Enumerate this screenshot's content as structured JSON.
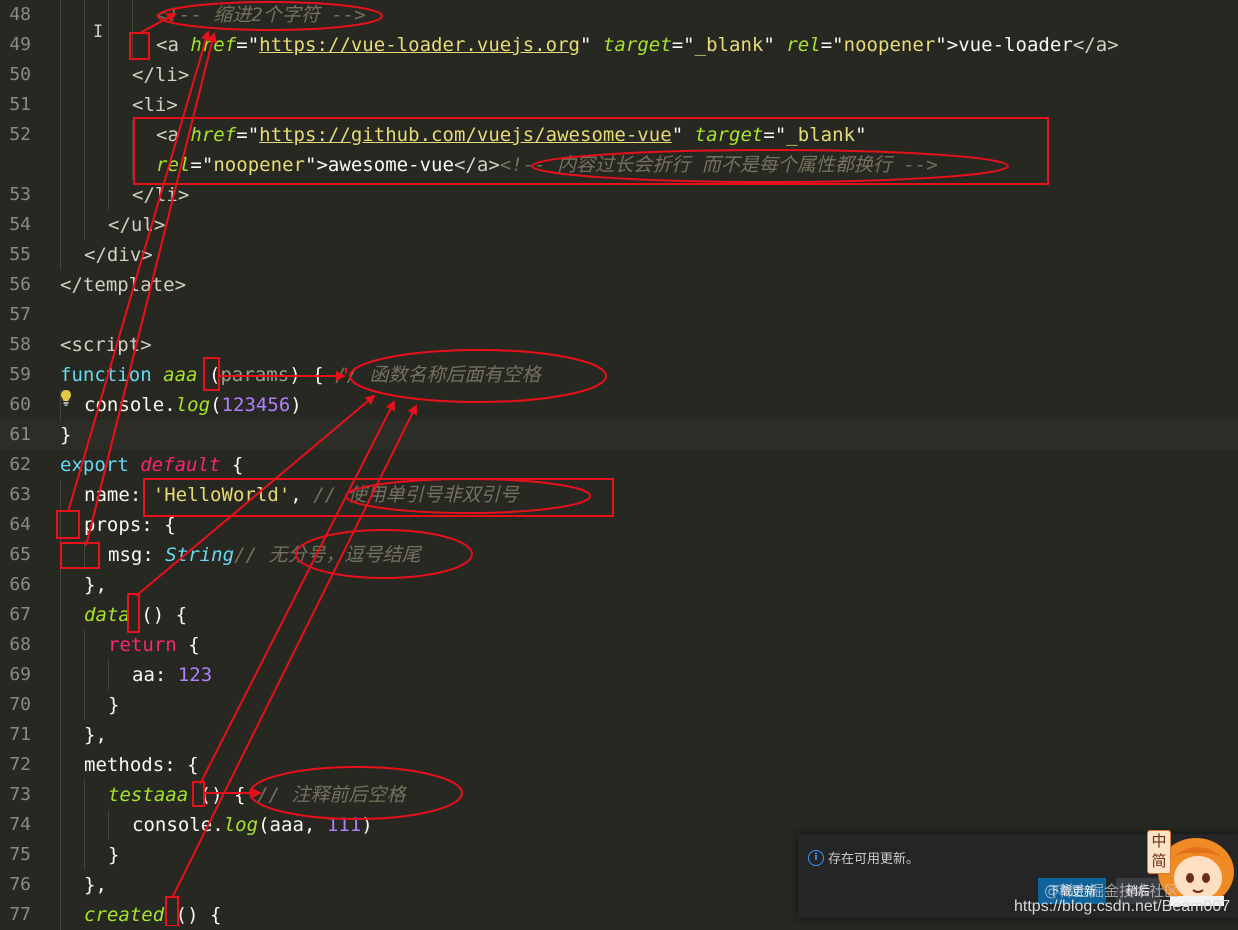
{
  "editor": {
    "lines": [
      {
        "n": "48",
        "tokens": [
          {
            "c": "t-com",
            "t": "<!-- 缩进2个字符 -->"
          }
        ]
      },
      {
        "n": "49",
        "tokens": [
          {
            "c": "t-tag",
            "t": "<a "
          },
          {
            "c": "t-attr",
            "t": "href"
          },
          {
            "c": "t-plain",
            "t": "=\""
          },
          {
            "c": "t-url",
            "t": "https://vue-loader.vuejs.org"
          },
          {
            "c": "t-plain",
            "t": "\" "
          },
          {
            "c": "t-attr",
            "t": "target"
          },
          {
            "c": "t-plain",
            "t": "=\""
          },
          {
            "c": "t-str",
            "t": "_blank"
          },
          {
            "c": "t-plain",
            "t": "\" "
          },
          {
            "c": "t-attr",
            "t": "rel"
          },
          {
            "c": "t-plain",
            "t": "=\""
          },
          {
            "c": "t-str",
            "t": "noopener"
          },
          {
            "c": "t-plain",
            "t": "\">vue-loader"
          },
          {
            "c": "t-tag",
            "t": "</a>"
          }
        ]
      },
      {
        "n": "50",
        "tokens": [
          {
            "c": "t-tag",
            "t": "</li>"
          }
        ]
      },
      {
        "n": "51",
        "tokens": [
          {
            "c": "t-tag",
            "t": "<li>"
          }
        ]
      },
      {
        "n": "52",
        "tokens": [
          {
            "c": "t-tag",
            "t": "<a "
          },
          {
            "c": "t-attr",
            "t": "href"
          },
          {
            "c": "t-plain",
            "t": "=\""
          },
          {
            "c": "t-url",
            "t": "https://github.com/vuejs/awesome-vue"
          },
          {
            "c": "t-plain",
            "t": "\" "
          },
          {
            "c": "t-attr",
            "t": "target"
          },
          {
            "c": "t-plain",
            "t": "=\""
          },
          {
            "c": "t-str",
            "t": "_blank"
          },
          {
            "c": "t-plain",
            "t": "\""
          }
        ]
      },
      {
        "n": "",
        "tokens": [
          {
            "c": "t-attr",
            "t": "rel"
          },
          {
            "c": "t-plain",
            "t": "=\""
          },
          {
            "c": "t-str",
            "t": "noopener"
          },
          {
            "c": "t-plain",
            "t": "\">awesome-vue"
          },
          {
            "c": "t-tag",
            "t": "</a>"
          },
          {
            "c": "t-com",
            "t": "<!-- 内容过长会折行 而不是每个属性都换行 -->"
          }
        ]
      },
      {
        "n": "53",
        "tokens": [
          {
            "c": "t-tag",
            "t": "</li>"
          }
        ]
      },
      {
        "n": "54",
        "tokens": [
          {
            "c": "t-tag",
            "t": "</ul>"
          }
        ]
      },
      {
        "n": "55",
        "tokens": [
          {
            "c": "t-tag",
            "t": "</div>"
          }
        ]
      },
      {
        "n": "56",
        "tokens": [
          {
            "c": "t-tag",
            "t": "</template>"
          }
        ]
      },
      {
        "n": "57",
        "tokens": []
      },
      {
        "n": "58",
        "tokens": [
          {
            "c": "t-tag",
            "t": "<script>"
          }
        ]
      },
      {
        "n": "59",
        "tokens": [
          {
            "c": "t-kw",
            "t": "function "
          },
          {
            "c": "t-fn",
            "t": "aaa"
          },
          {
            "c": "t-plain",
            "t": " ("
          },
          {
            "c": "t-dim",
            "t": "params"
          },
          {
            "c": "t-plain",
            "t": ") { "
          },
          {
            "c": "t-com",
            "t": "// 函数名称后面有空格"
          }
        ]
      },
      {
        "n": "60",
        "tokens": [
          {
            "c": "t-plain",
            "t": "console."
          },
          {
            "c": "t-fn",
            "t": "log"
          },
          {
            "c": "t-plain",
            "t": "("
          },
          {
            "c": "t-num",
            "t": "123456"
          },
          {
            "c": "t-plain",
            "t": ")"
          }
        ]
      },
      {
        "n": "61",
        "tokens": [
          {
            "c": "t-plain",
            "t": "}"
          }
        ]
      },
      {
        "n": "62",
        "tokens": [
          {
            "c": "t-kw",
            "t": "export "
          },
          {
            "c": "t-kwi",
            "t": "default"
          },
          {
            "c": "t-plain",
            "t": " {"
          }
        ]
      },
      {
        "n": "63",
        "tokens": [
          {
            "c": "t-plain",
            "t": "name: "
          },
          {
            "c": "t-str",
            "t": "'HelloWorld'"
          },
          {
            "c": "t-plain",
            "t": ", "
          },
          {
            "c": "t-com",
            "t": "// 使用单引号非双引号"
          }
        ]
      },
      {
        "n": "64",
        "tokens": [
          {
            "c": "t-plain",
            "t": "props: {"
          }
        ]
      },
      {
        "n": "65",
        "tokens": [
          {
            "c": "t-plain",
            "t": "msg: "
          },
          {
            "c": "t-type",
            "t": "String"
          },
          {
            "c": "t-com",
            "t": "// 无分号，逗号结尾"
          }
        ]
      },
      {
        "n": "66",
        "tokens": [
          {
            "c": "t-plain",
            "t": "},"
          }
        ]
      },
      {
        "n": "67",
        "tokens": [
          {
            "c": "t-fn",
            "t": "data"
          },
          {
            "c": "t-plain",
            "t": " () {"
          }
        ]
      },
      {
        "n": "68",
        "tokens": [
          {
            "c": "t-red",
            "t": "return"
          },
          {
            "c": "t-plain",
            "t": " {"
          }
        ]
      },
      {
        "n": "69",
        "tokens": [
          {
            "c": "t-plain",
            "t": "aa: "
          },
          {
            "c": "t-num",
            "t": "123"
          }
        ]
      },
      {
        "n": "70",
        "tokens": [
          {
            "c": "t-plain",
            "t": "}"
          }
        ]
      },
      {
        "n": "71",
        "tokens": [
          {
            "c": "t-plain",
            "t": "},"
          }
        ]
      },
      {
        "n": "72",
        "tokens": [
          {
            "c": "t-plain",
            "t": "methods: {"
          }
        ]
      },
      {
        "n": "73",
        "tokens": [
          {
            "c": "t-fn",
            "t": "testaaa"
          },
          {
            "c": "t-plain",
            "t": " () { "
          },
          {
            "c": "t-com",
            "t": "// 注释前后空格"
          }
        ]
      },
      {
        "n": "74",
        "tokens": [
          {
            "c": "t-plain",
            "t": "console."
          },
          {
            "c": "t-fn",
            "t": "log"
          },
          {
            "c": "t-plain",
            "t": "(aaa, "
          },
          {
            "c": "t-num",
            "t": "111"
          },
          {
            "c": "t-plain",
            "t": ")"
          }
        ]
      },
      {
        "n": "75",
        "tokens": [
          {
            "c": "t-plain",
            "t": "}"
          }
        ]
      },
      {
        "n": "76",
        "tokens": [
          {
            "c": "t-plain",
            "t": "},"
          }
        ]
      },
      {
        "n": "77",
        "tokens": [
          {
            "c": "t-fn",
            "t": "created"
          },
          {
            "c": "t-plain",
            "t": " () {"
          }
        ]
      }
    ]
  },
  "notification": {
    "message": "存在可用更新。",
    "primary_button": "下载更新",
    "secondary_button": "稍后",
    "badge_top": "中",
    "badge_bottom": "简"
  },
  "watermark": {
    "site": "@稀土掘金技术社区",
    "url": "https://blog.csdn.net/Beam007"
  },
  "colors": {
    "annotation": "#e8101a",
    "background": "#272822"
  },
  "icons": [
    "lightbulb-icon",
    "text-cursor-icon",
    "info-icon",
    "mascot-avatar"
  ]
}
